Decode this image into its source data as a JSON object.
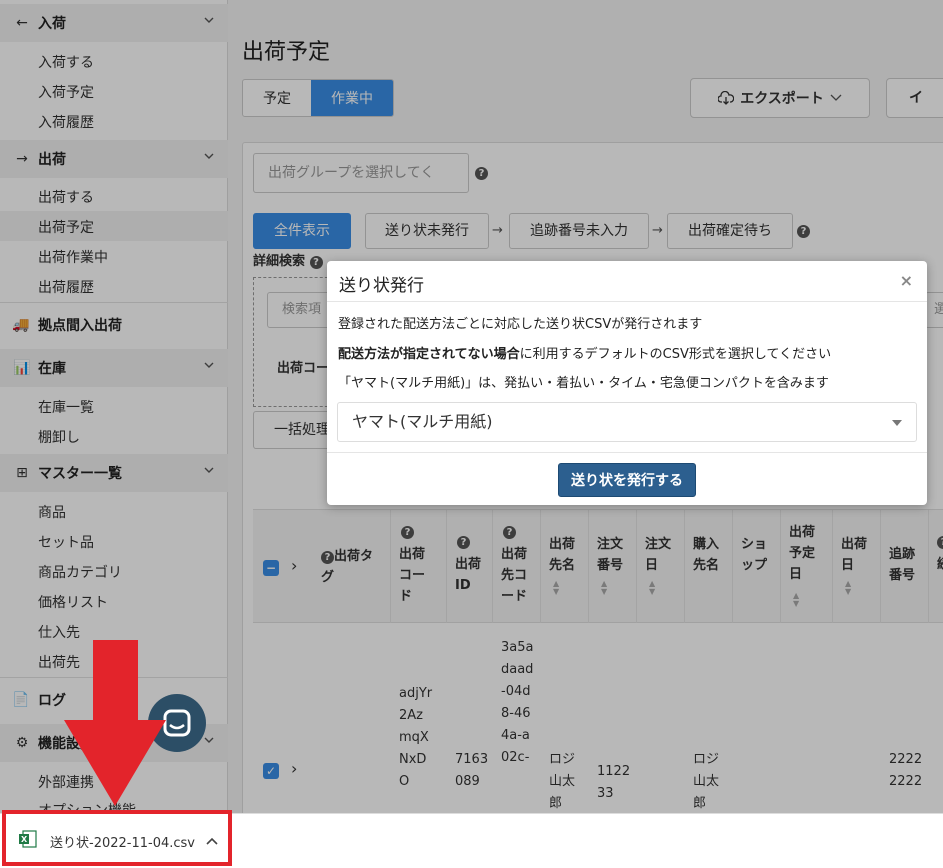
{
  "sidebar": {
    "sections": [
      {
        "icon": "←",
        "label": "入荷",
        "items": [
          "入荷する",
          "入荷予定",
          "入荷履歴"
        ]
      },
      {
        "icon": "→",
        "label": "出荷",
        "items": [
          "出荷する",
          "出荷予定",
          "出荷作業中",
          "出荷履歴"
        ]
      },
      {
        "icon": "🚚",
        "label": "拠点間入出荷"
      },
      {
        "icon": "📊",
        "label": "在庫",
        "items": [
          "在庫一覧",
          "棚卸し"
        ]
      },
      {
        "icon": "⊞",
        "label": "マスター一覧",
        "items": [
          "商品",
          "セット品",
          "商品カテゴリ",
          "価格リスト",
          "仕入先",
          "出荷先"
        ]
      },
      {
        "icon": "📄",
        "label": "ログ"
      },
      {
        "icon": "⚙",
        "label": "機能設定",
        "items": [
          "外部連携",
          "オプション機能"
        ]
      }
    ]
  },
  "main": {
    "title": "出荷予定",
    "tabs": [
      "予定",
      "作業中"
    ],
    "export_label": "エクスポート",
    "import_label": "イ",
    "group_placeholder": "出荷グループを選択してく",
    "flow": [
      "全件表示",
      "送り状未発行",
      "追跡番号未入力",
      "出荷確定待ち"
    ],
    "detail_search": "詳細検索",
    "search_placeholder": "検索項",
    "code_label": "出荷コー",
    "right_select": "選",
    "bulk_label": "一括処理"
  },
  "table": {
    "headers": [
      "出荷タグ",
      "出荷コード",
      "出荷ID",
      "出荷先コード",
      "出荷先名",
      "注文番号",
      "注文日",
      "購入先名",
      "ショップ",
      "出荷予定日",
      "出荷日",
      "追跡番号",
      "続"
    ],
    "row": {
      "code": "adjYr2AzmqXNxDO",
      "id": "7163089",
      "dest_code": "3a5adaad-04d8-464a-a02c-",
      "dest_name": "ロジ山太郎",
      "order_no": "112233",
      "buyer": "ロジ山太郎",
      "tracking": "22222222"
    }
  },
  "modal": {
    "title": "送り状発行",
    "close": "×",
    "line1": "登録された配送方法ごとに対応した送り状CSVが発行されます",
    "line2_bold": "配送方法が指定されてない場合",
    "line2_rest": "に利用するデフォルトのCSV形式を選択してください",
    "line3": "「ヤマト(マルチ用紙)」は、発払い・着払い・タイム・宅急便コンパクトを含みます",
    "select_value": "ヤマト(マルチ用紙)",
    "submit": "送り状を発行する"
  },
  "download": {
    "filename": "送り状-2022-11-04.csv"
  },
  "colors": {
    "primary": "#3a8ee6",
    "modal_button": "#2c5f8f",
    "highlight": "#e3242b"
  }
}
